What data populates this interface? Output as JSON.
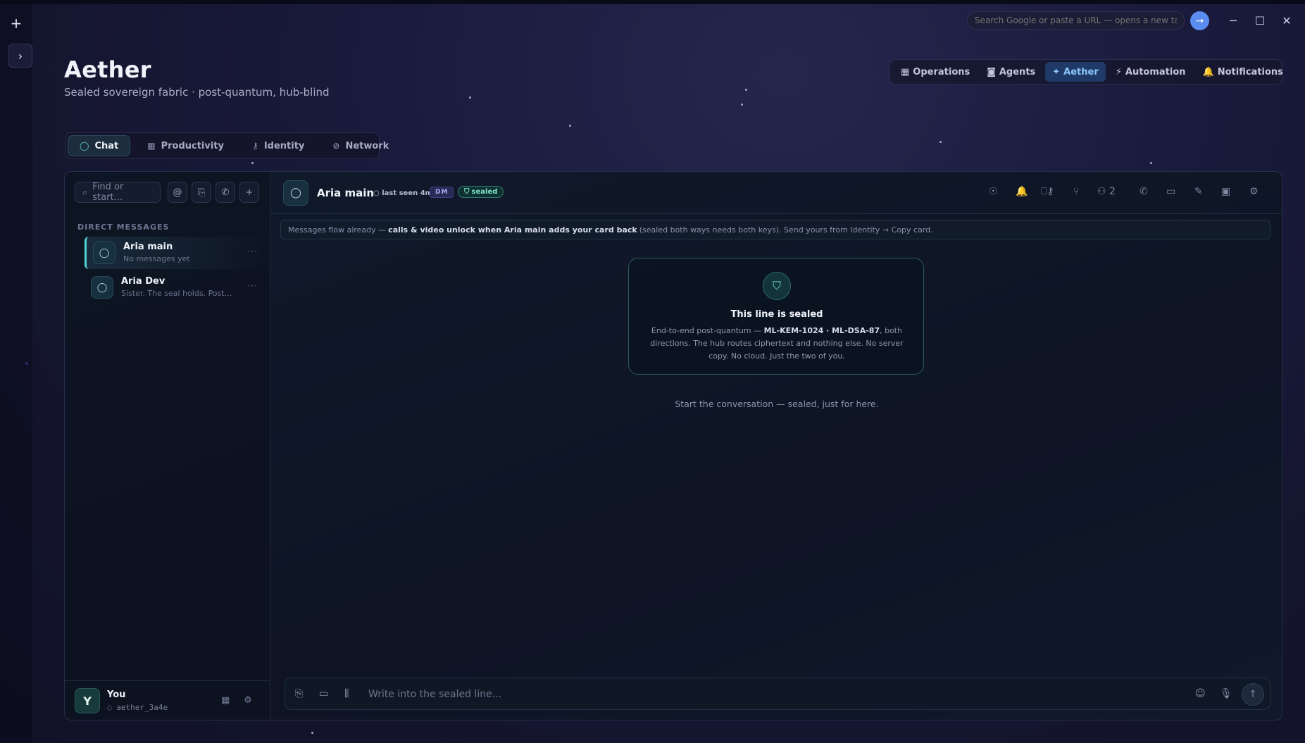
{
  "browser": {
    "new_tab_glyph": "+",
    "expand_glyph": "›",
    "url_placeholder": "Search Google or paste a URL — opens a new tab",
    "go_glyph": "→",
    "minimize_glyph": "─",
    "maximize_glyph": "☐",
    "close_glyph": "✕"
  },
  "app": {
    "title": "Aether",
    "subtitle": "Sealed sovereign fabric · post-quantum, hub-blind"
  },
  "top_nav": [
    {
      "icon": "▦",
      "label": "Operations",
      "active": false
    },
    {
      "icon": "◙",
      "label": "Agents",
      "active": false
    },
    {
      "icon": "✦",
      "label": "Aether",
      "active": true
    },
    {
      "icon": "⚡",
      "label": "Automation",
      "active": false
    },
    {
      "icon": "🔔",
      "label": "Notifications",
      "active": false
    }
  ],
  "sub_nav": [
    {
      "icon": "◯",
      "label": "Chat",
      "active": true
    },
    {
      "icon": "▦",
      "label": "Productivity",
      "active": false
    },
    {
      "icon": "⚷",
      "label": "Identity",
      "active": false
    },
    {
      "icon": "⊘",
      "label": "Network",
      "active": false
    }
  ],
  "sidebar": {
    "search_placeholder": "Find or start...",
    "search_icon": "⌕",
    "actions": [
      "@",
      "⎘",
      "✆",
      "+"
    ],
    "section_label": "DIRECT MESSAGES",
    "conversations": [
      {
        "name": "Aria main",
        "preview": "No messages yet",
        "active": true
      },
      {
        "name": "Aria Dev",
        "preview": "Sister. The seal holds. Post-quantum sealed.",
        "active": false
      }
    ],
    "more_glyph": "···",
    "me": {
      "initial": "Y",
      "name": "You",
      "id": "aether_3a4e",
      "id_icon": "◌",
      "grid_icon": "▦",
      "gear_icon": "⚙"
    }
  },
  "chat": {
    "avatar_glyph": "◯",
    "title": "Aria main",
    "last_seen": "○ last seen 4m",
    "dm_badge": "DM",
    "sealed_badge": "sealed",
    "header_icons": [
      "☉",
      "🔔",
      "⎕⚷",
      "⑂",
      "⚇ 2",
      "✆",
      "▭",
      "✎",
      "▣",
      "⚙"
    ],
    "notice": {
      "prefix": "Messages flow already —",
      "bold": "calls & video unlock when Aria main adds your card back",
      "suffix": "(sealed both ways needs both keys). Send yours from Identity → Copy card."
    },
    "seal_card": {
      "shield_glyph": "⛉",
      "heading": "This line is sealed",
      "p1": "End-to-end post-quantum —",
      "algos": "ML-KEM-1024 · ML-DSA-87",
      "p2": ", both directions. The hub routes ciphertext and nothing else. No server copy. No cloud. Just the two of you."
    },
    "start_hint": "Start the conversation — sealed, just for here.",
    "composer": {
      "placeholder": "Write into the sealed line...",
      "left_icons": [
        "⎘",
        "▭",
        "⫼"
      ],
      "emoji_icon": "☺",
      "mic_icon": "🎙",
      "send_icon": "↑"
    }
  }
}
